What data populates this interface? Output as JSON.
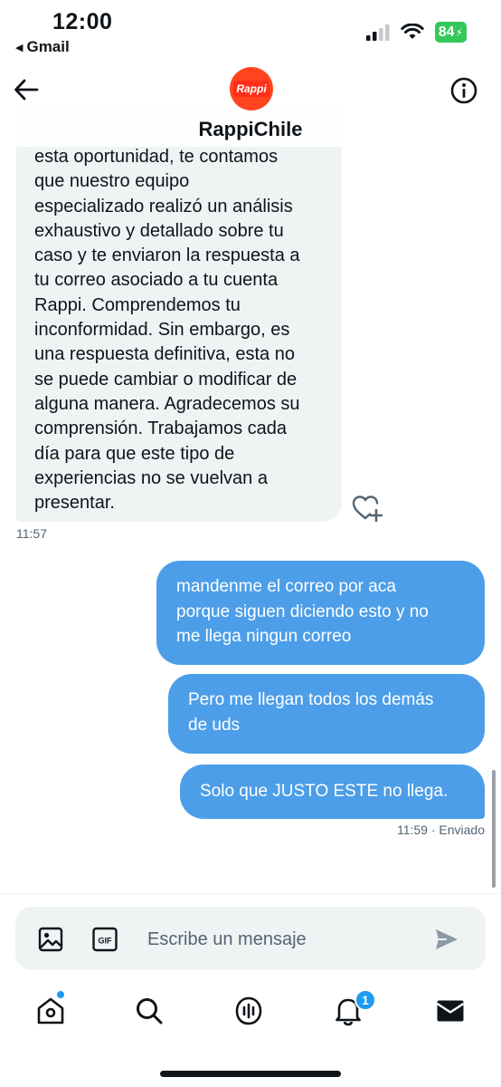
{
  "status_bar": {
    "time": "12:00",
    "back_app": "Gmail",
    "battery": "84"
  },
  "header": {
    "avatar_text": "Rappi",
    "title": "RappiChile"
  },
  "conversation": {
    "incoming": {
      "partial_top_line": "esta oportunidad, te contamos",
      "lines": [
        "que nuestro equipo",
        "especializado realizó un análisis",
        "exhaustivo y detallado sobre tu",
        "caso y te enviaron la respuesta a",
        "tu correo asociado a tu cuenta",
        "Rappi. Comprendemos tu",
        "inconformidad. Sin embargo, es",
        "una respuesta definitiva, esta no",
        "se puede cambiar o modificar de",
        "alguna manera. Agradecemos su",
        "comprensión. Trabajamos cada",
        "día para que este tipo de",
        "experiencias no se vuelvan a",
        "presentar."
      ],
      "time": "11:57"
    },
    "outgoing": [
      {
        "lines": [
          "mandenme el correo por aca",
          "porque siguen diciendo esto y no",
          "me llega ningun correo"
        ]
      },
      {
        "lines": [
          "Pero me llegan todos los demás",
          "de uds"
        ]
      },
      {
        "lines": [
          "Solo que JUSTO ESTE no llega."
        ]
      }
    ],
    "outgoing_status": "11:59 · Enviado"
  },
  "composer": {
    "placeholder": "Escribe un mensaje",
    "gif_label": "GIF"
  },
  "tabbar": {
    "notifications_badge": "1"
  },
  "colors": {
    "accent": "#1d9bf0",
    "outgoing_bubble": "#4c9ee8",
    "incoming_bubble": "#eff3f4",
    "brand": "#ff441f"
  },
  "icons": [
    "back-arrow-icon",
    "info-icon",
    "heart-plus-icon",
    "media-icon",
    "gif-icon",
    "send-icon",
    "home-icon",
    "search-icon",
    "spaces-icon",
    "notifications-icon",
    "messages-icon"
  ]
}
